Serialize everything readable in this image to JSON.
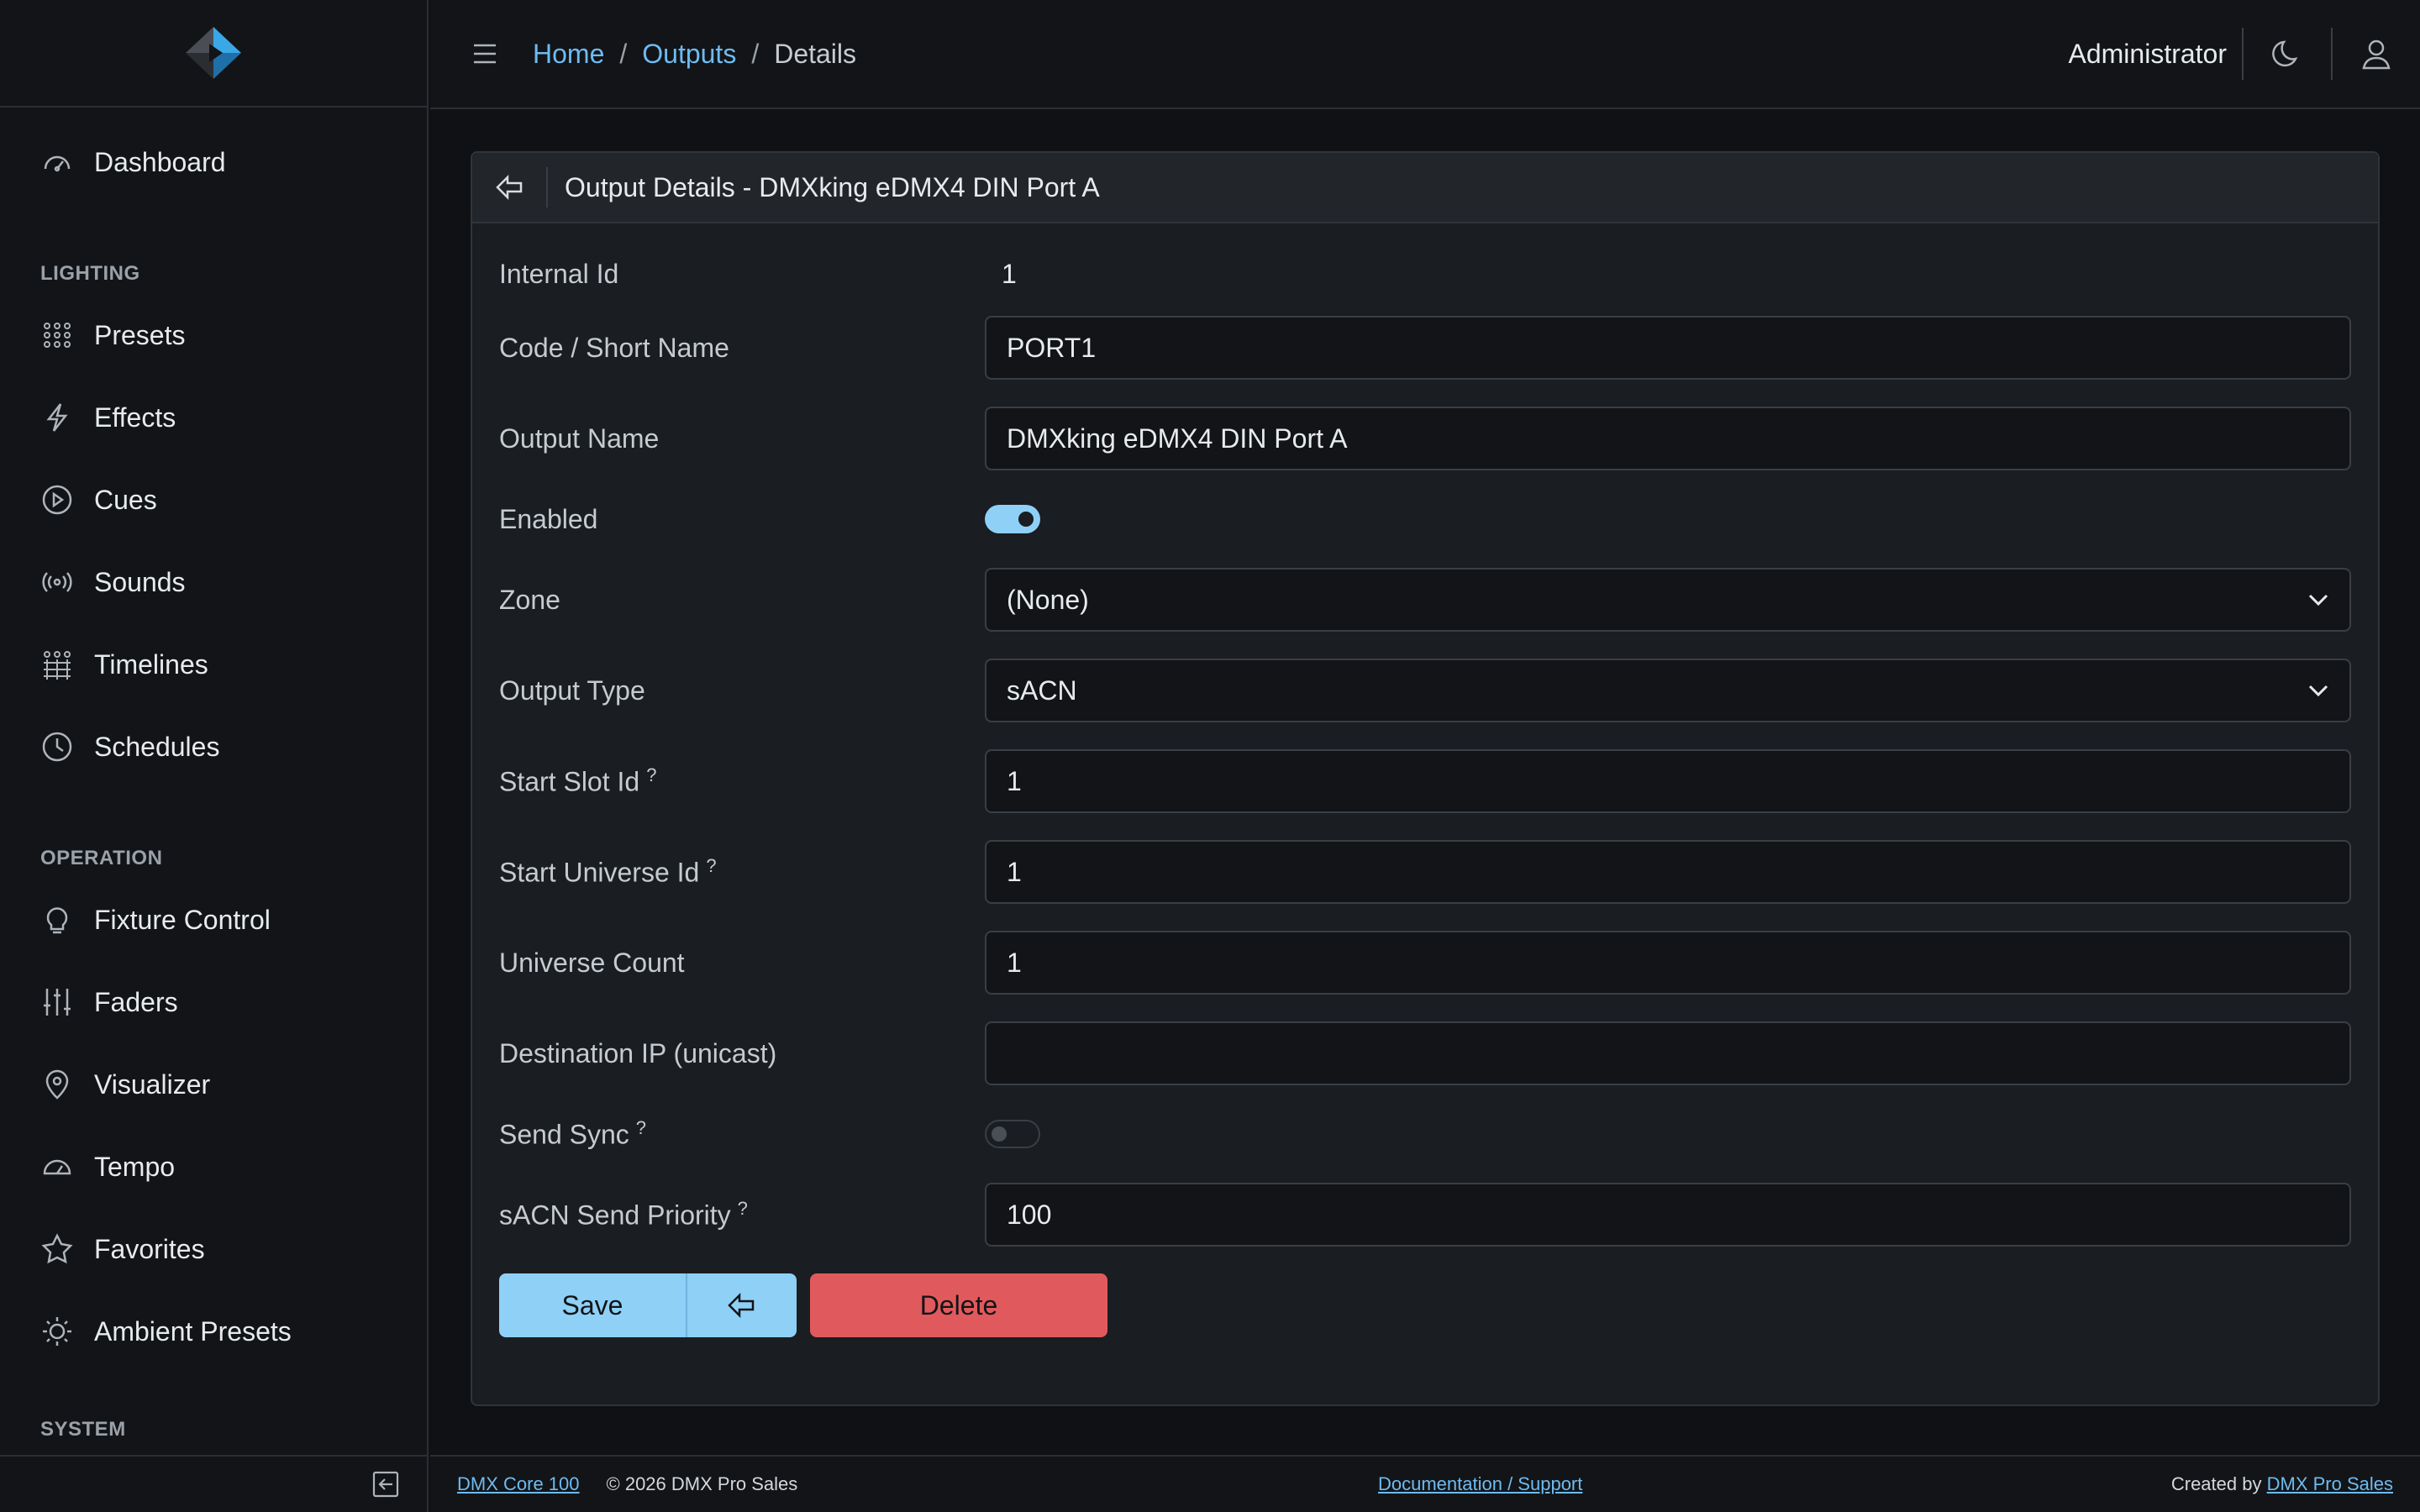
{
  "sidebar": {
    "items_top": [
      {
        "label": "Dashboard",
        "icon": "gauge-icon"
      }
    ],
    "section_lighting": "LIGHTING",
    "items_lighting": [
      {
        "label": "Presets",
        "icon": "grid-dots-icon"
      },
      {
        "label": "Effects",
        "icon": "lightning-icon"
      },
      {
        "label": "Cues",
        "icon": "play-circle-icon"
      },
      {
        "label": "Sounds",
        "icon": "broadcast-icon"
      },
      {
        "label": "Timelines",
        "icon": "timeline-grid-icon"
      },
      {
        "label": "Schedules",
        "icon": "clock-icon"
      }
    ],
    "section_operation": "OPERATION",
    "items_operation": [
      {
        "label": "Fixture Control",
        "icon": "lightbulb-icon"
      },
      {
        "label": "Faders",
        "icon": "sliders-icon"
      },
      {
        "label": "Visualizer",
        "icon": "map-pin-icon"
      },
      {
        "label": "Tempo",
        "icon": "speedometer-icon"
      },
      {
        "label": "Favorites",
        "icon": "star-icon"
      },
      {
        "label": "Ambient Presets",
        "icon": "sun-icon"
      }
    ],
    "section_system": "SYSTEM"
  },
  "topbar": {
    "breadcrumb": {
      "home": "Home",
      "outputs": "Outputs",
      "current": "Details",
      "sep": "/"
    },
    "user": "Administrator"
  },
  "card": {
    "title": "Output Details - DMXking eDMX4 DIN Port A"
  },
  "form": {
    "internal_id": {
      "label": "Internal Id",
      "value": "1"
    },
    "code": {
      "label": "Code / Short Name",
      "value": "PORT1"
    },
    "output_name": {
      "label": "Output Name",
      "value": "DMXking eDMX4 DIN Port A"
    },
    "enabled": {
      "label": "Enabled",
      "value": true
    },
    "zone": {
      "label": "Zone",
      "value": "(None)"
    },
    "output_type": {
      "label": "Output Type",
      "value": "sACN"
    },
    "start_slot": {
      "label": "Start Slot Id",
      "help": "?",
      "value": "1"
    },
    "start_universe": {
      "label": "Start Universe Id",
      "help": "?",
      "value": "1"
    },
    "universe_count": {
      "label": "Universe Count",
      "value": "1"
    },
    "destination_ip": {
      "label": "Destination IP (unicast)",
      "value": ""
    },
    "send_sync": {
      "label": "Send Sync",
      "help": "?",
      "value": false
    },
    "priority": {
      "label": "sACN Send Priority",
      "help": "?",
      "value": "100"
    }
  },
  "actions": {
    "save": "Save",
    "delete": "Delete"
  },
  "footer": {
    "product": "DMX Core 100",
    "copyright": "© 2026 DMX Pro Sales",
    "docs": "Documentation / Support",
    "created_by": "Created by",
    "creator": "DMX Pro Sales"
  },
  "colors": {
    "accent": "#8fd0f7",
    "danger": "#e05a5d",
    "link": "#6ebbf2"
  }
}
